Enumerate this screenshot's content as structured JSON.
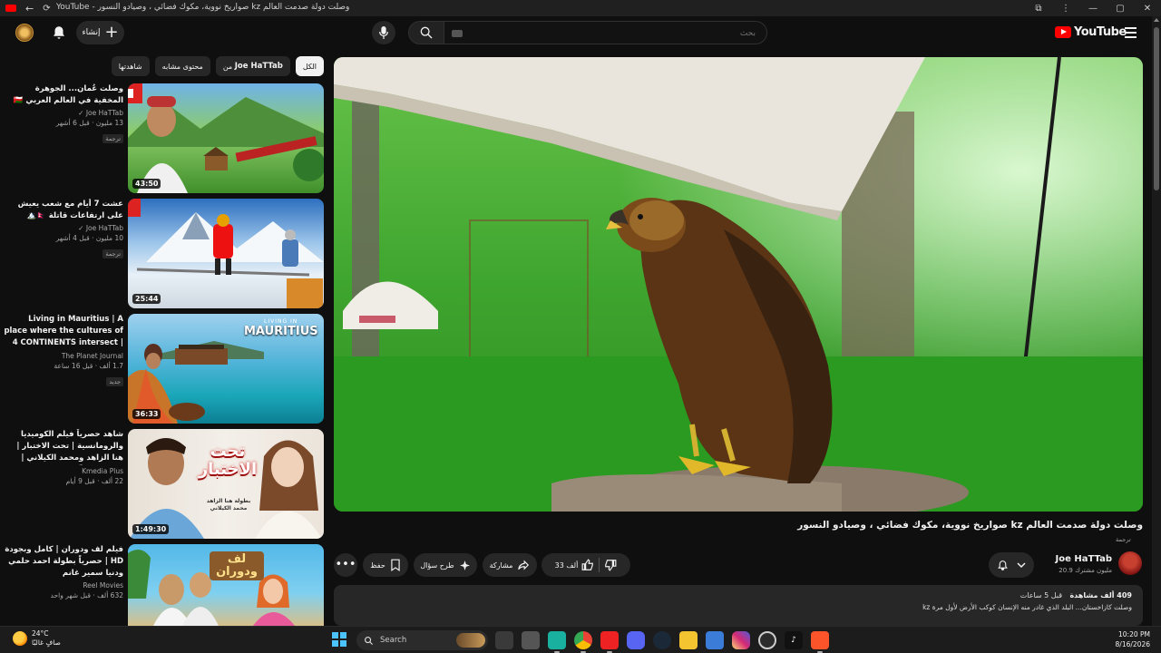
{
  "window": {
    "title": "YouTube - صواريخ نووية، مكوك فضائي ، وصيادو النسور kz وصلت دولة صدمت العالم",
    "minimize_icon": "—",
    "maximize_icon": "▢",
    "close_icon": "✕"
  },
  "masthead": {
    "create_label": "إنشاء",
    "search_placeholder": "بحث",
    "logo_text": "YouTube"
  },
  "chips": [
    {
      "label": "الكل",
      "active": true
    },
    {
      "label_prefix": "من ",
      "label_bold": "Joe HaTTab",
      "active": false
    },
    {
      "label": "محتوى مشابه",
      "active": false
    },
    {
      "label": "شاهدتها",
      "active": false
    }
  ],
  "recommendations": [
    {
      "title": "وصلت عُمان... الجوهرة المخفية في العالم العربي 🇴🇲",
      "channel": "Joe HaTTab ✓",
      "meta": "13 مليون · قبل 6 أشهر",
      "badge": "ترجمة",
      "duration": "43:50"
    },
    {
      "title": "عشت 7 أيام مع شعب يعيش على ارتفاعات قاتلة 🇳🇵🏔️",
      "channel": "Joe HaTTab ✓",
      "meta": "10 مليون · قبل 4 أشهر",
      "badge": "ترجمة",
      "duration": "25:44"
    },
    {
      "title": "Living in Mauritius | A place where the cultures of 4 CONTINENTS intersect | 4K ...",
      "channel": "The Planet Journal",
      "meta": "1.7 ألف · قبل 16 ساعة",
      "badge": "جديد",
      "duration": "36:33"
    },
    {
      "title": "شاهد حصرياً فيلم الكوميديا والرومانسية | تحت الاختبار | هنا الزاهد ومحمد الكيلاني | FULL HD 🎬",
      "channel": "Kmedia Plus",
      "meta": "22 ألف · قبل 9 أيام",
      "badge": "",
      "duration": "1:49:30"
    },
    {
      "title": "فيلم لف ودوران | كامل وبجودة HD | حصرياً بطولة احمد حلمي ودنيا سمير غانم",
      "channel": "Reel Movies",
      "meta": "632 ألف · قبل شهر واحد",
      "badge": "",
      "duration": ""
    }
  ],
  "thumbnail_texts": {
    "mauritius": "MAURITIUS",
    "mauritius_sub": "LIVING IN",
    "movie1_title": "تحت الاختبار",
    "movie1_credit": "بطولة هنا الزاهد محمد الكيلاني",
    "movie2_title": "لف ودوران"
  },
  "video": {
    "title": "وصلت دولة صدمت العالم kz صواريخ نووية، مكوك فضائي ، وصيادو النسور",
    "caption_tag": "ترجمة",
    "channel_name": "Joe HaTTab",
    "channel_subs": "20.9 مليون مشترك",
    "likes": "33 ألف",
    "share_label": "مشاركة",
    "ask_label": "طرح سؤال",
    "save_label": "حفظ",
    "views_bold": "409 ألف مشاهدة",
    "date": "قبل 5 ساعات",
    "description": "وصلت كازاخستان... البلد الذي غادر منه الإنسان كوكب الأرض لأول مرة kz"
  },
  "taskbar": {
    "temp": "24°C",
    "weather_text": "صافٍ غالبًا",
    "search_label": "Search",
    "time": "10:20 PM",
    "date": "8/16/2026"
  },
  "colors": {
    "bg": "#0f0f0f",
    "chip": "#272727",
    "accent_red": "#ff0000"
  }
}
